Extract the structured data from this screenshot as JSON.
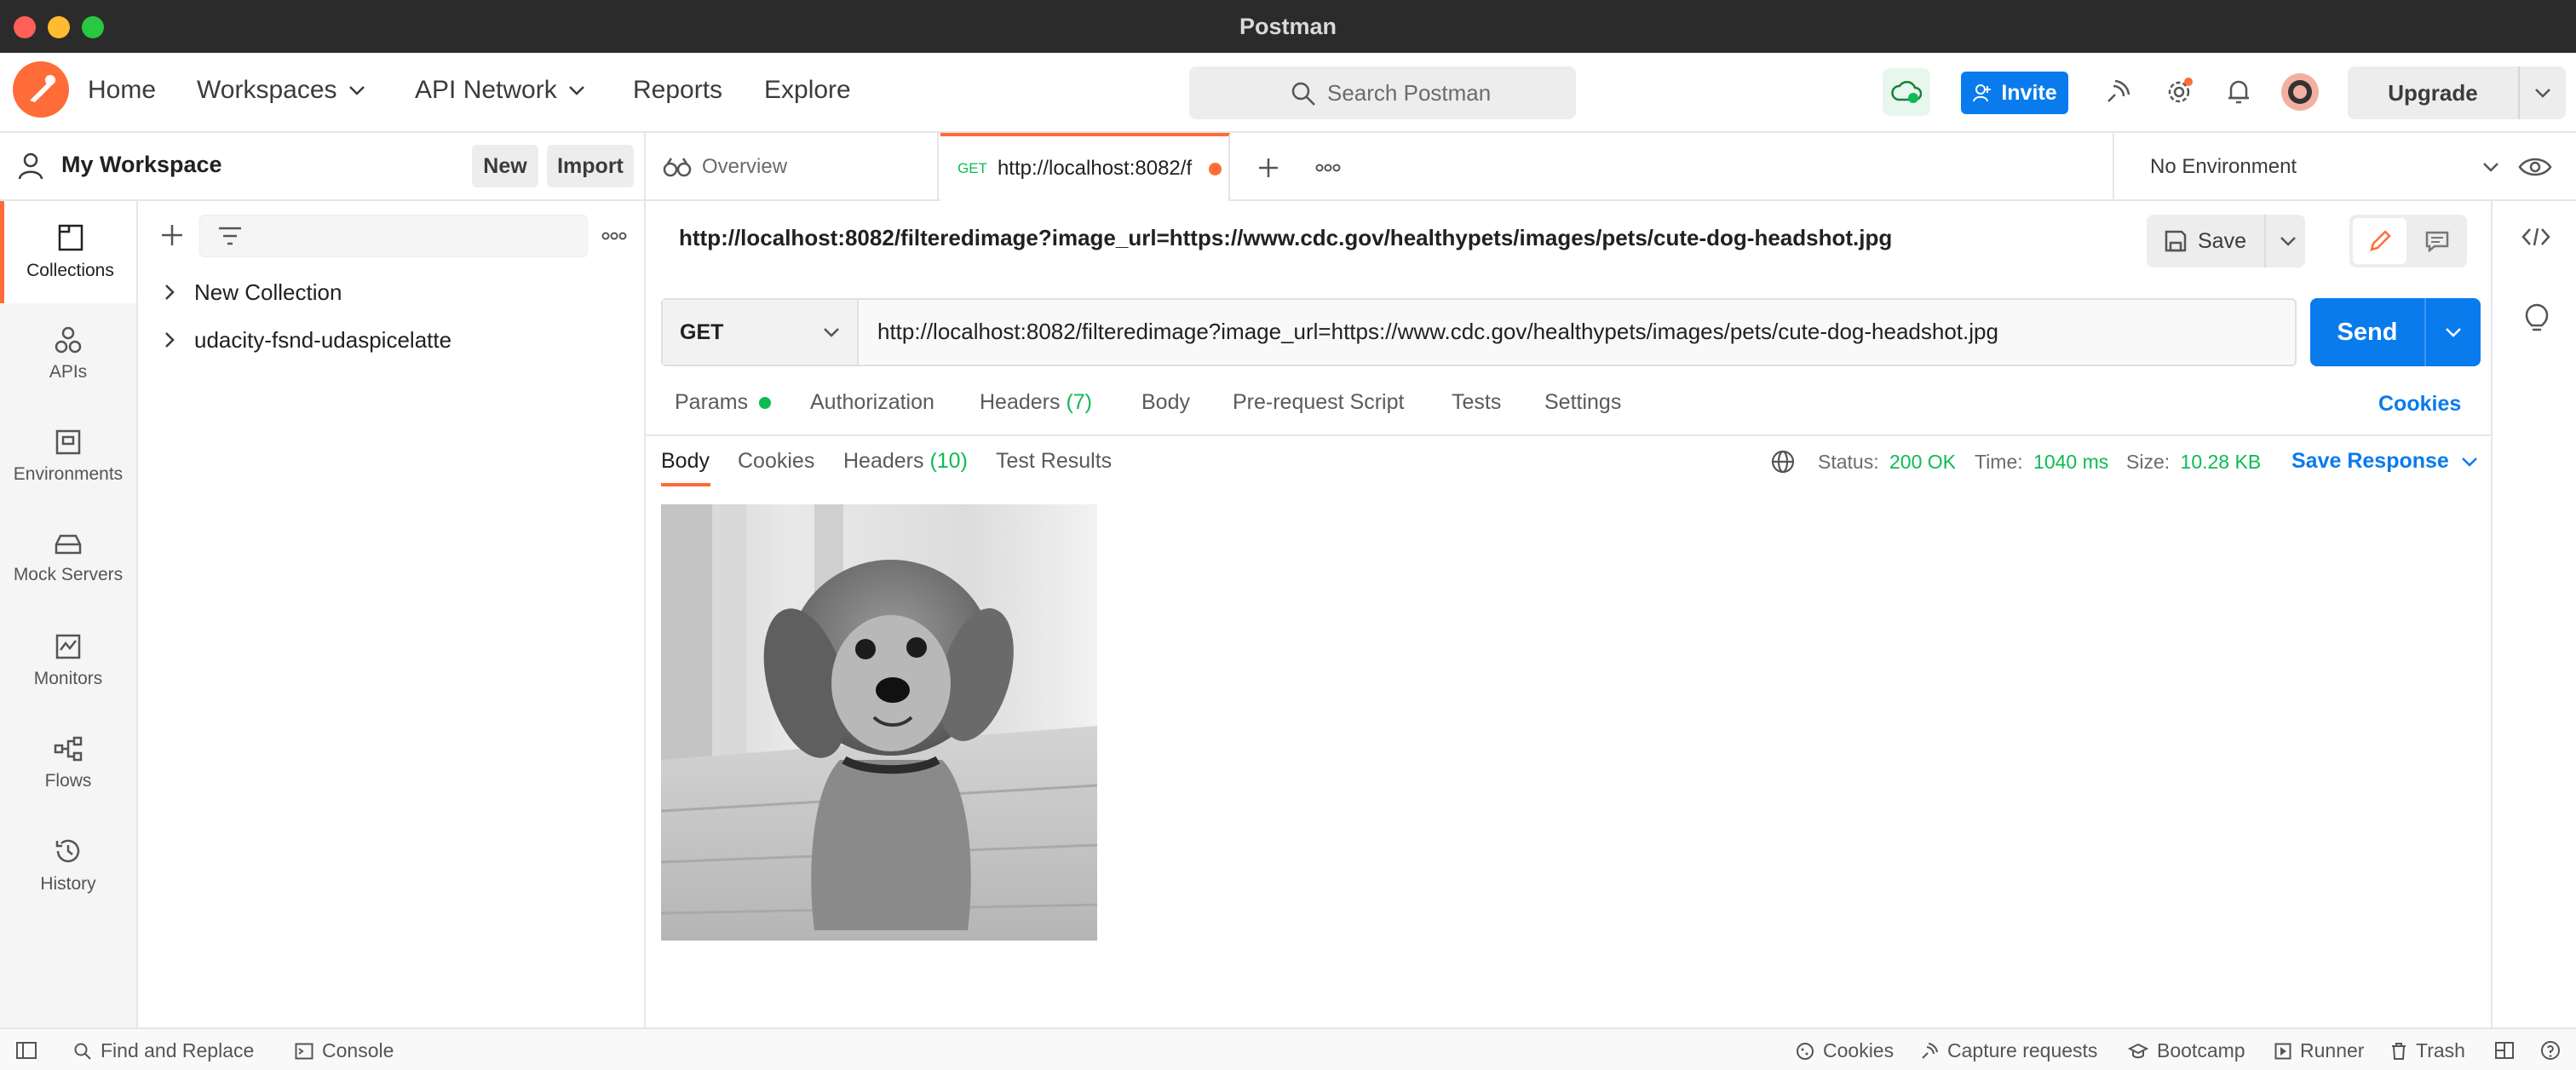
{
  "window": {
    "title": "Postman"
  },
  "header": {
    "nav": [
      "Home",
      "Workspaces",
      "API Network",
      "Reports",
      "Explore"
    ],
    "search_placeholder": "Search Postman",
    "invite_label": "Invite",
    "upgrade_label": "Upgrade"
  },
  "workspace": {
    "title": "My Workspace",
    "new_label": "New",
    "import_label": "Import"
  },
  "rail": [
    "Collections",
    "APIs",
    "Environments",
    "Mock Servers",
    "Monitors",
    "Flows",
    "History"
  ],
  "collections": [
    "New Collection",
    "udacity-fsnd-udaspicelatte"
  ],
  "tabs": {
    "overview": "Overview",
    "active_method": "GET",
    "active_label": "http://localhost:8082/f",
    "environment": "No Environment"
  },
  "request": {
    "name": "http://localhost:8082/filteredimage?image_url=https://www.cdc.gov/healthypets/images/pets/cute-dog-headshot.jpg",
    "save_label": "Save",
    "method": "GET",
    "url": "http://localhost:8082/filteredimage?image_url=https://www.cdc.gov/healthypets/images/pets/cute-dog-headshot.jpg",
    "send_label": "Send",
    "tabs": {
      "params": "Params",
      "authorization": "Authorization",
      "headers": "Headers",
      "headers_count": "(7)",
      "body": "Body",
      "prerequest": "Pre-request Script",
      "tests": "Tests",
      "settings": "Settings"
    },
    "cookies_link": "Cookies"
  },
  "response": {
    "tabs": {
      "body": "Body",
      "cookies": "Cookies",
      "headers": "Headers",
      "headers_count": "(10)",
      "test_results": "Test Results"
    },
    "status_label": "Status:",
    "status_value": "200 OK",
    "time_label": "Time:",
    "time_value": "1040 ms",
    "size_label": "Size:",
    "size_value": "10.28 KB",
    "save_response": "Save Response"
  },
  "footer": {
    "find_replace": "Find and Replace",
    "console": "Console",
    "cookies": "Cookies",
    "capture": "Capture requests",
    "bootcamp": "Bootcamp",
    "runner": "Runner",
    "trash": "Trash"
  },
  "colors": {
    "accent": "#ff6c37",
    "primary": "#097bed",
    "success": "#0cbb52"
  }
}
